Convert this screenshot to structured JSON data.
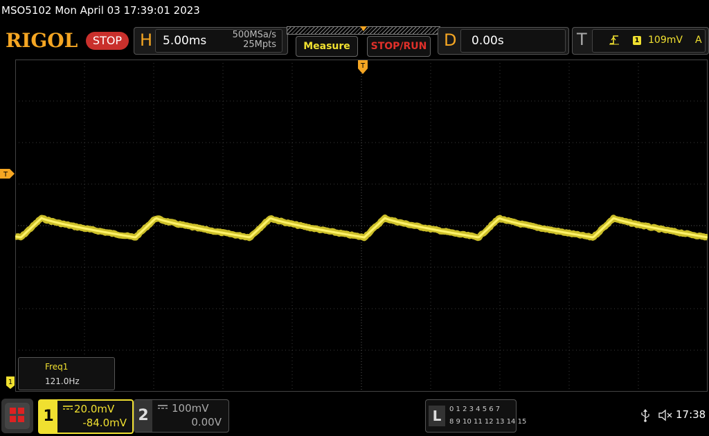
{
  "title": "MSO5102  Mon April 03 17:39:01 2023",
  "brand": "RIGOL",
  "run_state": "STOP",
  "horizontal": {
    "letter": "H",
    "timebase": "5.00ms",
    "sample_rate": "500MSa/s",
    "memory_depth": "25Mpts"
  },
  "buttons": {
    "measure": "Measure",
    "stop_run": "STOP/RUN"
  },
  "delay": {
    "letter": "D",
    "value": "0.00s"
  },
  "trigger": {
    "letter": "T",
    "edge_icon": "rising-edge-icon",
    "source": "1",
    "level": "109mV",
    "mode": "A",
    "level_marker": "T",
    "position_marker": "T"
  },
  "measurement": {
    "name": "Freq1",
    "value": "121.0Hz"
  },
  "channel1": {
    "number": "1",
    "coupling_icon": "dc-coupling-icon",
    "scale": "20.0mV",
    "offset": "-84.0mV",
    "color": "#f0e030",
    "marker": "1"
  },
  "channel2": {
    "number": "2",
    "coupling_icon": "dc-coupling-icon",
    "scale": "100mV",
    "offset": "0.00V"
  },
  "logic": {
    "letter": "L",
    "row1": "0 1 2 3   4 5 6 7",
    "row2": "8  9 10 11  12 13 14 15"
  },
  "status": {
    "time": "17:38",
    "usb_icon": "usb-icon",
    "speaker_icon": "speaker-muted-icon"
  },
  "colors": {
    "accent": "#f5a623",
    "stop": "#c9302c",
    "trace": "#f0e030"
  },
  "waveform": {
    "frequency_hz": 121.0,
    "timebase_ms_per_div": 5.0,
    "volts_per_div_mv": 20.0,
    "cycles_visible": 6
  }
}
